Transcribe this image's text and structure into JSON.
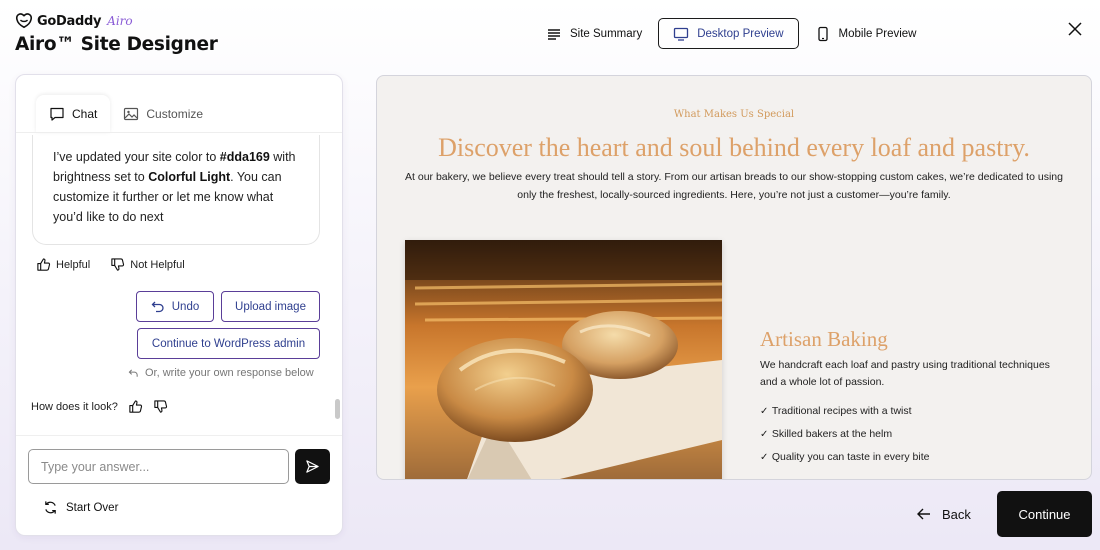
{
  "brand": {
    "name": "GoDaddy",
    "product": "Airo",
    "app_title": "Airo™ Site Designer"
  },
  "nav": {
    "site_summary": "Site Summary",
    "desktop_preview": "Desktop Preview",
    "mobile_preview": "Mobile Preview",
    "active": "desktop_preview"
  },
  "tabs": [
    {
      "label": "Chat",
      "active": true
    },
    {
      "label": "Customize",
      "active": false
    }
  ],
  "chat": {
    "message_part1": "I’ve updated your site color to ",
    "color_value": "#dda169",
    "message_part2": " with brightness set to ",
    "brightness_value": "Colorful Light",
    "message_part3": ". You can customize it further or let me know what you’d like to do next",
    "helpful": "Helpful",
    "not_helpful": "Not Helpful",
    "undo": "Undo",
    "upload_image": "Upload image",
    "continue_wordpress": "Continue to WordPress admin",
    "hint": "Or, write your own response below",
    "how_look": "How does it look?",
    "input_placeholder": "Type your answer...",
    "input_value": "",
    "start_over": "Start Over"
  },
  "preview": {
    "kicker": "What Makes Us Special",
    "heading": "Discover the heart and soul behind every loaf and pastry.",
    "intro_line1": "At our bakery, we believe every treat should tell a story. From our artisan breads to our show-stopping custom cakes, we’re dedicated to using",
    "intro_line2": "only the freshest, locally-sourced ingredients. Here, you’re not just a customer—you’re family.",
    "sub_heading": "Artisan Baking",
    "sub_text": "We handcraft each loaf and pastry using traditional techniques and a whole lot of passion.",
    "list": [
      "Traditional recipes with a twist",
      "Skilled bakers at the helm",
      "Quality you can taste in every bite"
    ],
    "accent_color": "#dda169"
  },
  "footer": {
    "back": "Back",
    "continue": "Continue"
  },
  "colors": {
    "accent": "#dda169",
    "brand_purple": "#8a5cd6",
    "button_border": "#5a3e98",
    "link_text": "#2f3f8f"
  },
  "icons": [
    "godaddy-logo-icon",
    "list-icon",
    "desktop-icon",
    "mobile-icon",
    "close-icon",
    "chat-icon",
    "image-icon",
    "thumbs-up-icon",
    "thumbs-down-icon",
    "undo-icon",
    "reply-icon",
    "send-icon",
    "refresh-icon",
    "arrow-left-icon"
  ]
}
